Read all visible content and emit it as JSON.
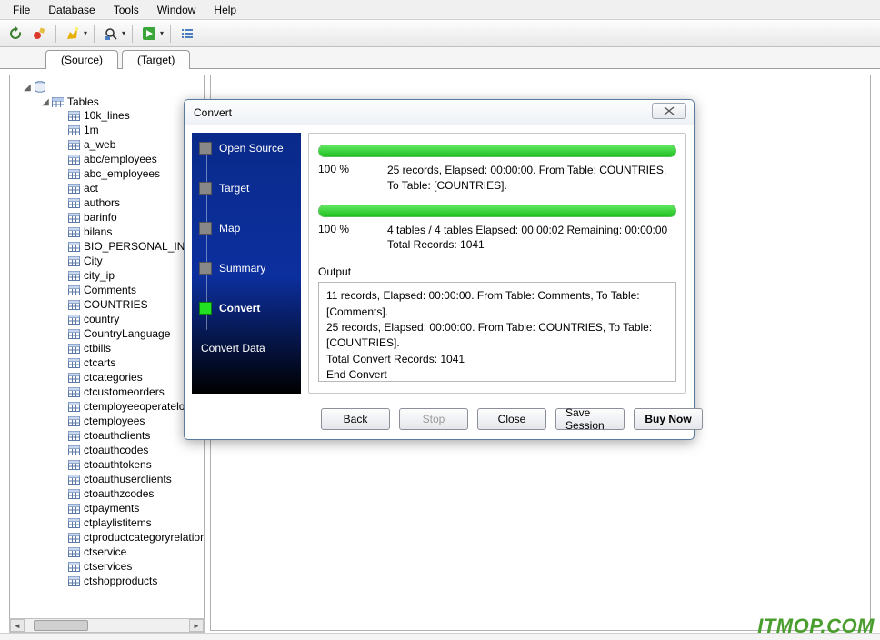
{
  "menu": {
    "items": [
      "File",
      "Database",
      "Tools",
      "Window",
      "Help"
    ]
  },
  "tabs": {
    "source": "(Source)",
    "target": "(Target)"
  },
  "tree": {
    "tables_label": "Tables",
    "items": [
      "10k_lines",
      "1m",
      "a_web",
      "abc/employees",
      "abc_employees",
      "act",
      "authors",
      "barinfo",
      "bilans",
      "BIO_PERSONAL_INF",
      "City",
      "city_ip",
      "Comments",
      "COUNTRIES",
      "country",
      "CountryLanguage",
      "ctbills",
      "ctcarts",
      "ctcategories",
      "ctcustomeorders",
      "ctemployeeoperatelog",
      "ctemployees",
      "ctoauthclients",
      "ctoauthcodes",
      "ctoauthtokens",
      "ctoauthuserclients",
      "ctoauthzcodes",
      "ctpayments",
      "ctplaylistitems",
      "ctproductcategoryrelation",
      "ctservice",
      "ctservices",
      "ctshopproducts"
    ]
  },
  "dialog": {
    "title": "Convert",
    "steps": [
      "Open Source",
      "Target",
      "Map",
      "Summary",
      "Convert"
    ],
    "active_step": "Convert",
    "footer": "Convert Data",
    "bar1": {
      "pct": "100 %",
      "line": "25 records,   Elapsed: 00:00:00.   From Table: COUNTRIES, To Table: [COUNTRIES]."
    },
    "bar2": {
      "pct": "100 %",
      "line": "4 tables / 4 tables   Elapsed: 00:00:02   Remaining: 00:00:00 Total Records: 1041"
    },
    "output_label": "Output",
    "output_lines": [
      "11 records,   Elapsed: 00:00:00.   From Table: Comments,   To Table: [Comments].",
      "25 records,   Elapsed: 00:00:00.   From Table: COUNTRIES,   To Table: [COUNTRIES].",
      "Total Convert Records: 1041",
      "End Convert"
    ],
    "buttons": {
      "back": "Back",
      "stop": "Stop",
      "close": "Close",
      "save": "Save Session",
      "buy": "Buy Now"
    }
  },
  "watermark": "ITMOP.COM"
}
